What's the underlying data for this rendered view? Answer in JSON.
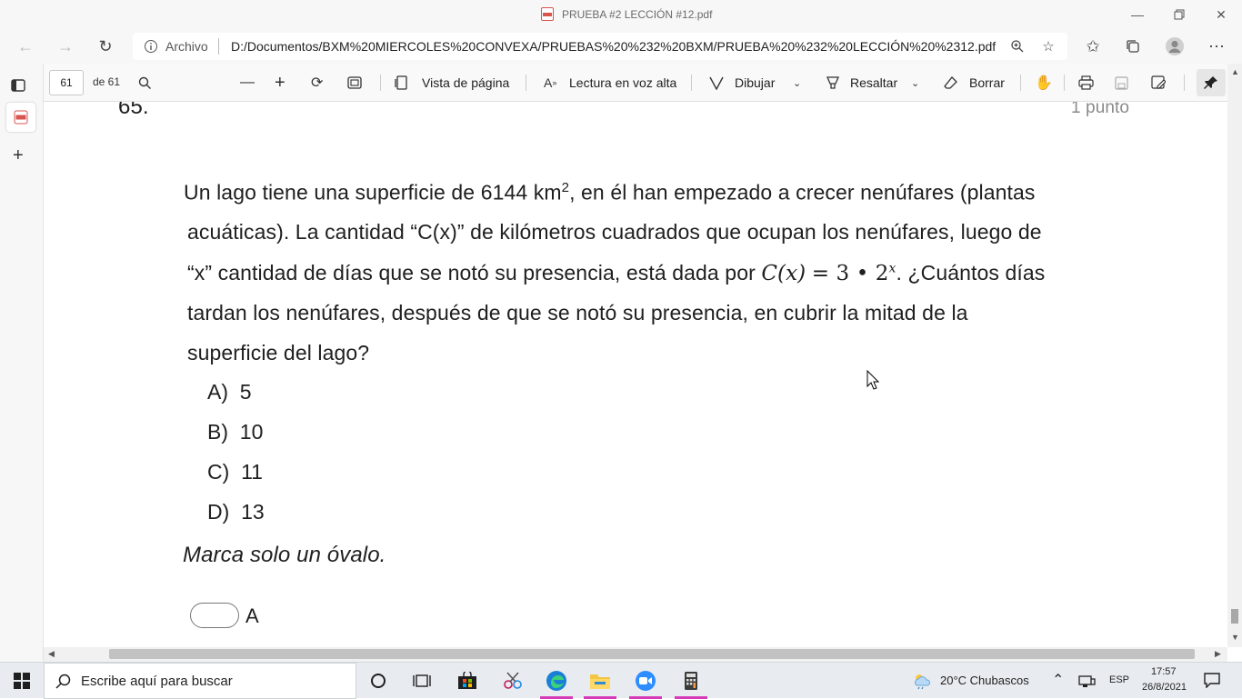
{
  "window": {
    "title": "PRUEBA #2 LECCIÓN #12.pdf"
  },
  "address": {
    "scheme_label": "Archivo",
    "url": "D:/Documentos/BXM%20MIERCOLES%20CONVEXA/PRUEBAS%20%232%20BXM/PRUEBA%20%232%20LECCIÓN%20%2312.pdf"
  },
  "pdf_toolbar": {
    "page_current": "61",
    "page_total": "de 61",
    "page_view": "Vista de página",
    "read_aloud": "Lectura en voz alta",
    "draw": "Dibujar",
    "highlight": "Resaltar",
    "erase": "Borrar"
  },
  "question": {
    "number": "65.",
    "points": "1 punto",
    "line1_a": "Un lago tiene una superficie de 6144 km",
    "line1_sup": "2",
    "line1_b": ", en él han empezado a crecer nenúfares (plantas",
    "line2": "acuáticas). La cantidad “C(x)” de kilómetros cuadrados que ocupan los nenúfares, luego de",
    "line3_a": "“x” cantidad de días que se notó su presencia, está dada por",
    "formula_lhs": "C(x)",
    "formula_eq": "= 3 • 2",
    "formula_exp": "x",
    "line3_b": ". ¿Cuántos días",
    "line4": "tardan los nenúfares, después de que se notó su presencia, en cubrir la mitad de la",
    "line5": "superficie del lago?",
    "options": [
      {
        "letter": "A)",
        "value": "5"
      },
      {
        "letter": "B)",
        "value": "10"
      },
      {
        "letter": "C)",
        "value": "11"
      },
      {
        "letter": "D)",
        "value": "13"
      }
    ],
    "instruction": "Marca solo un óvalo.",
    "answer_choice_label": "A"
  },
  "taskbar": {
    "search_placeholder": "Escribe aquí para buscar",
    "weather": "20°C  Chubascos",
    "language": "ESP",
    "time": "17:57",
    "date": "26/8/2021"
  },
  "colors": {
    "accent_pink": "#d63ab8",
    "text": "#202020"
  }
}
